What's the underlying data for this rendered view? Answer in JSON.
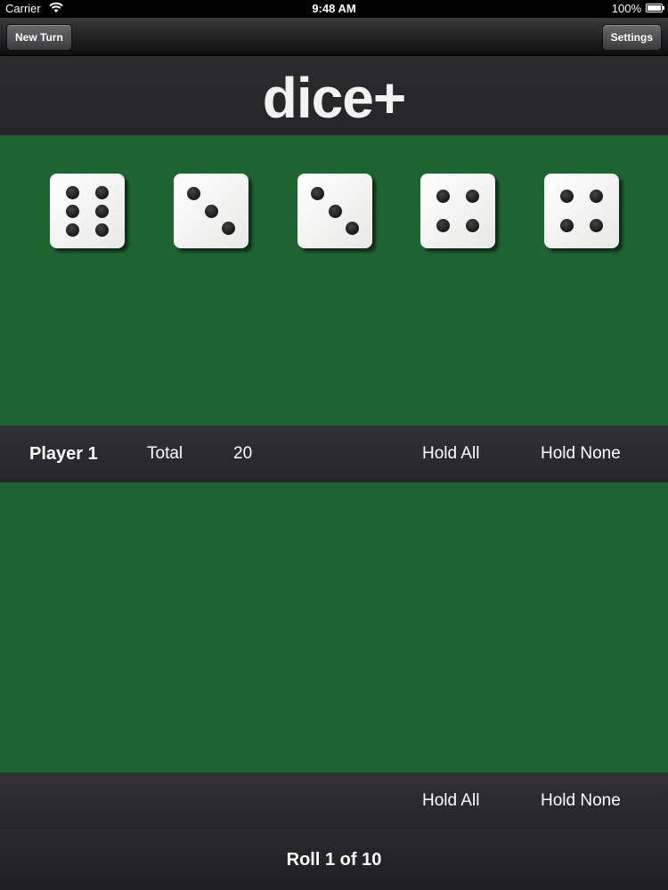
{
  "status_bar": {
    "carrier": "Carrier",
    "time": "9:48 AM",
    "battery": "100%"
  },
  "nav": {
    "new_turn_label": "New Turn",
    "settings_label": "Settings"
  },
  "app": {
    "logo": "dice+"
  },
  "dice": [
    6,
    3,
    3,
    4,
    4
  ],
  "player_bar": {
    "player_name": "Player 1",
    "total_label": "Total",
    "total_value": "20",
    "hold_all_label": "Hold All",
    "hold_none_label": "Hold None"
  },
  "held_bar": {
    "hold_all_label": "Hold All",
    "hold_none_label": "Hold None"
  },
  "footer": {
    "roll_status": "Roll 1 of 10"
  },
  "colors": {
    "felt": "#1d6430",
    "bar": "#2c2c2e",
    "text": "#ffffff"
  }
}
